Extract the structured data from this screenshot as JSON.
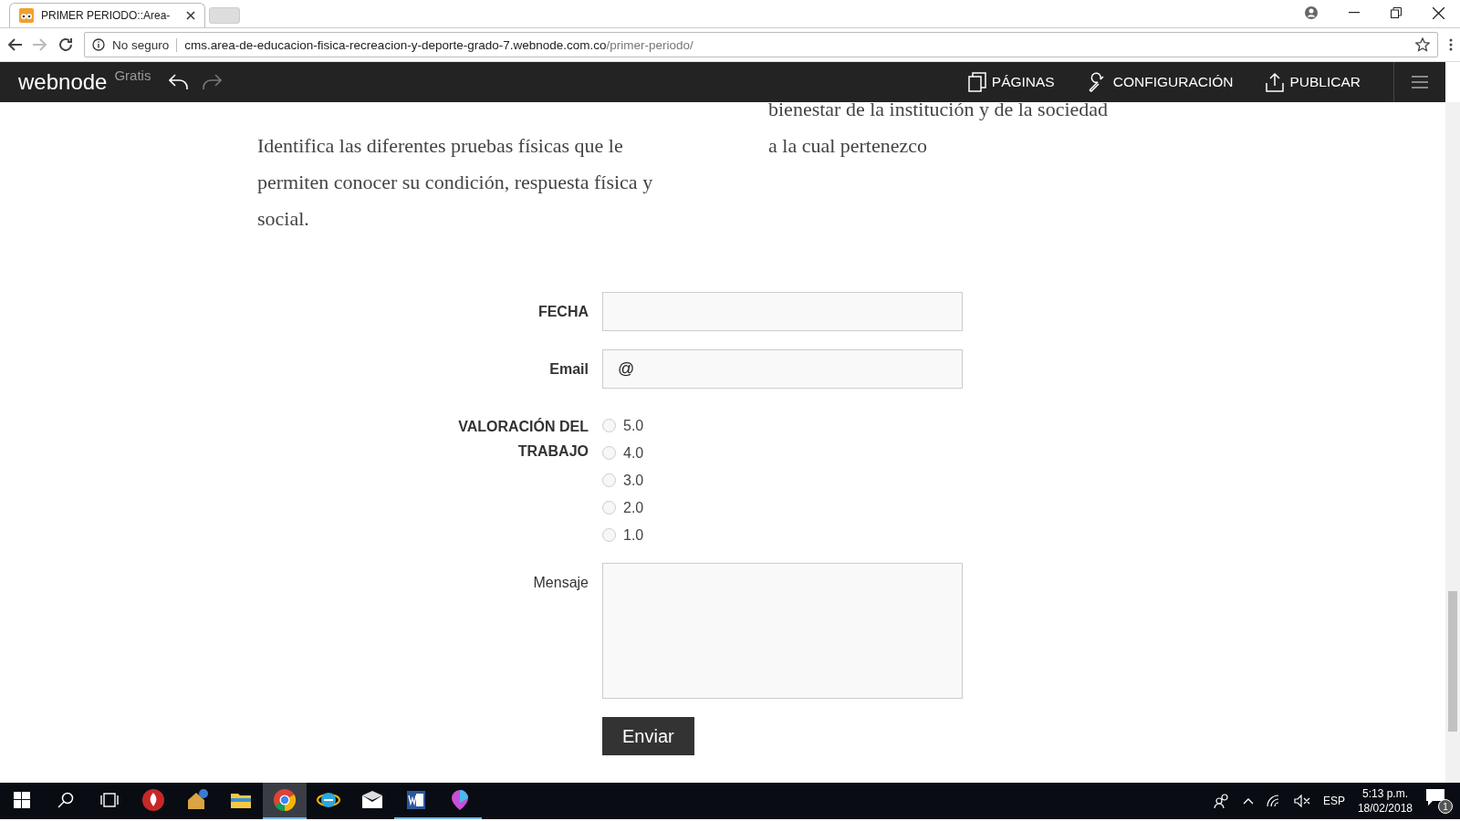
{
  "browser": {
    "tabs": [
      {
        "title": "PRIMER PERIODO::Area-",
        "selected": true
      }
    ],
    "security": "No seguro",
    "url_host": "cms.area-de-educacion-fisica-recreacion-y-deporte-grado-7.webnode.com.co",
    "url_path": "/primer-periodo/"
  },
  "editor_bar": {
    "logo": "webnode",
    "plan": "Gratis",
    "actions": [
      {
        "kind": "pages",
        "label": "PÁGINAS"
      },
      {
        "kind": "settings",
        "label": "CONFIGURACIÓN"
      },
      {
        "kind": "publish",
        "label": "PUBLICAR"
      }
    ]
  },
  "content": {
    "left_text": "Identifica las diferentes pruebas físicas que le permiten conocer su condición, respuesta física y social.",
    "right_text": "bienestar de la institución y de la sociedad a la cual pertenezco"
  },
  "form": {
    "fields": [
      {
        "kind": "text",
        "label": "FECHA",
        "required": true
      },
      {
        "kind": "text",
        "label": "Email",
        "required": true,
        "value": "@"
      },
      {
        "kind": "radio",
        "label": "VALORACIÓN DEL TRABAJO",
        "required": true,
        "options": [
          {
            "label": "5.0",
            "selected": false
          },
          {
            "label": "4.0",
            "selected": false
          },
          {
            "label": "3.0",
            "selected": false
          },
          {
            "label": "2.0",
            "selected": false
          },
          {
            "label": "1.0",
            "selected": false
          }
        ]
      },
      {
        "kind": "textarea",
        "label": "Mensaje",
        "required": false
      }
    ],
    "submit": "Enviar"
  },
  "taskbar": {
    "apps": [
      {
        "kind": "fire",
        "selected": false,
        "running": false
      },
      {
        "kind": "house",
        "selected": false,
        "running": false
      },
      {
        "kind": "folder",
        "selected": false,
        "running": false
      },
      {
        "kind": "chrome",
        "selected": true,
        "running": true
      },
      {
        "kind": "ie",
        "selected": false,
        "running": false
      },
      {
        "kind": "mail",
        "selected": false,
        "running": false
      },
      {
        "kind": "word",
        "selected": false,
        "running": true
      },
      {
        "kind": "paint",
        "selected": false,
        "running": true
      }
    ],
    "language": "ESP",
    "time": "5:13 p.m.",
    "date": "18/02/2018",
    "notifications": "1"
  }
}
